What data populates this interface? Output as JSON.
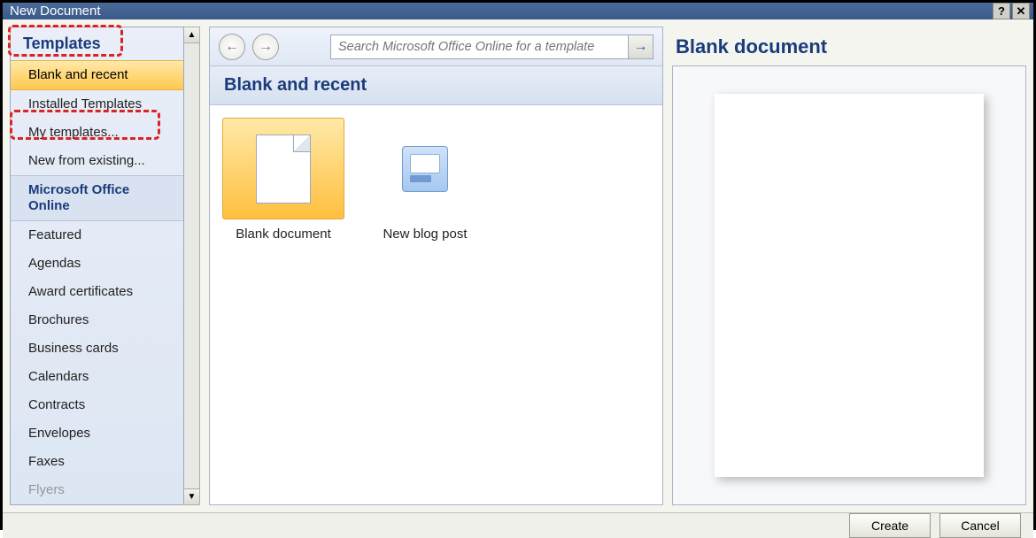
{
  "titlebar": {
    "title": "New Document"
  },
  "sidebar": {
    "header": "Templates",
    "items": [
      {
        "label": "Blank and recent",
        "selected": true
      },
      {
        "label": "Installed Templates"
      },
      {
        "label": "My templates..."
      },
      {
        "label": "New from existing..."
      },
      {
        "label": "Microsoft Office Online",
        "section": true
      },
      {
        "label": "Featured"
      },
      {
        "label": "Agendas"
      },
      {
        "label": "Award certificates"
      },
      {
        "label": "Brochures"
      },
      {
        "label": "Business cards"
      },
      {
        "label": "Calendars"
      },
      {
        "label": "Contracts"
      },
      {
        "label": "Envelopes"
      },
      {
        "label": "Faxes"
      },
      {
        "label": "Flyers"
      }
    ]
  },
  "toolbar": {
    "search_placeholder": "Search Microsoft Office Online for a template"
  },
  "main": {
    "section_title": "Blank and recent",
    "templates": [
      {
        "label": "Blank document",
        "kind": "page",
        "selected": true
      },
      {
        "label": "New blog post",
        "kind": "blog"
      }
    ]
  },
  "preview": {
    "title": "Blank document"
  },
  "footer": {
    "create": "Create",
    "cancel": "Cancel"
  }
}
